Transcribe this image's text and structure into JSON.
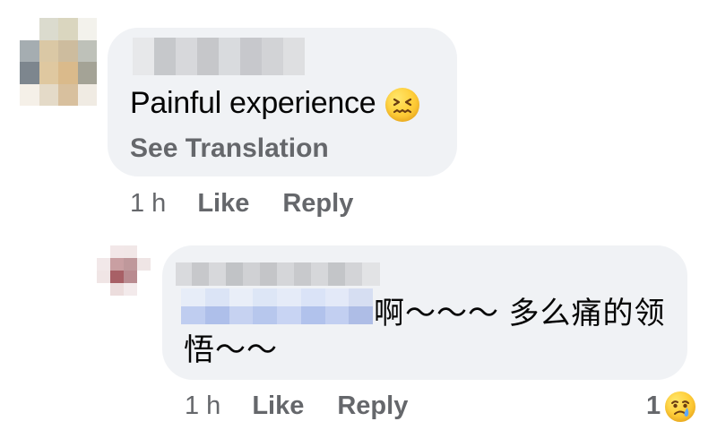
{
  "main_comment": {
    "text": "Painful experience",
    "reaction_emoji": "persevering-face",
    "see_translation_label": "See Translation",
    "time": "1 h",
    "like_label": "Like",
    "reply_label": "Reply"
  },
  "reply_comment": {
    "text_line1": "啊～～～ 多么痛的领",
    "text_line2": "悟～～",
    "time": "1 h",
    "like_label": "Like",
    "reply_label": "Reply",
    "reaction_count": "1",
    "reaction_emoji": "crying-face"
  },
  "colors": {
    "bubble_background": "#f0f2f5",
    "secondary_text": "#65676b",
    "primary_text": "#050505"
  }
}
